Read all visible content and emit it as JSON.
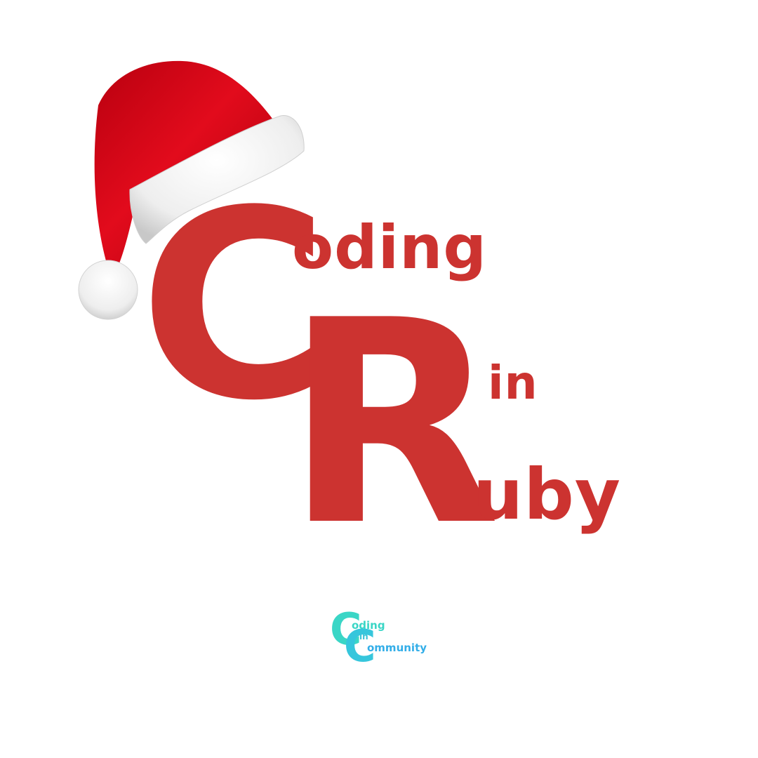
{
  "logo": {
    "letter_c": "C",
    "letter_r": "R",
    "word_coding": "oding",
    "word_in": "in",
    "word_ruby": "uby"
  },
  "footer_logo": {
    "letter_c1": "C",
    "letter_c2": "C",
    "word_coding": "oding",
    "word_in": "in",
    "word_community": "ommunity"
  },
  "colors": {
    "brand_red": "#cc3330",
    "hat_red": "#e01020",
    "fur_white": "#f4f4f4",
    "teal": "#3ad6c6",
    "sky": "#33aee8"
  },
  "icons": {
    "hat": "santa-hat-icon"
  }
}
